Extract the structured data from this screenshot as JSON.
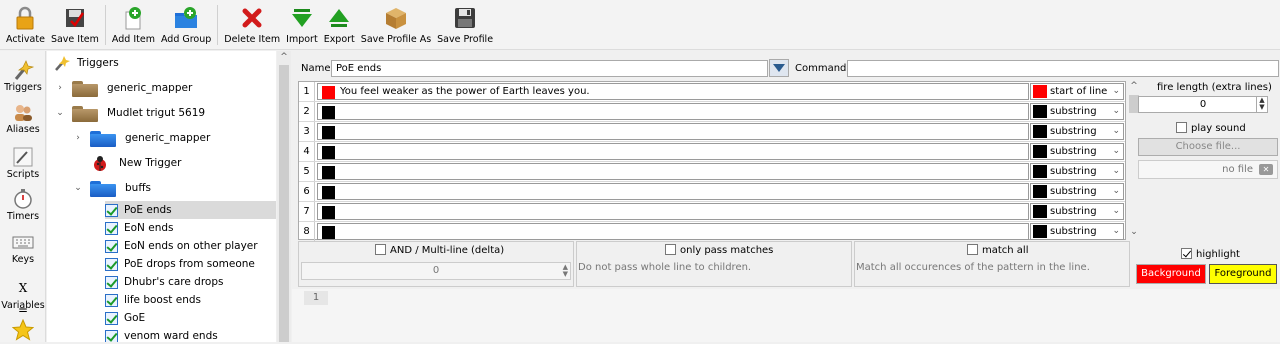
{
  "toolbar": {
    "buttons": [
      {
        "label": "Activate",
        "icon": "padlock-icon"
      },
      {
        "label": "Save Item",
        "icon": "save-item-icon"
      },
      {
        "label": "Add Item",
        "icon": "add-item-icon"
      },
      {
        "label": "Add Group",
        "icon": "add-group-icon"
      },
      {
        "label": "Delete Item",
        "icon": "delete-x-icon"
      },
      {
        "label": "Import",
        "icon": "import-arrow-icon"
      },
      {
        "label": "Export",
        "icon": "export-arrow-icon"
      },
      {
        "label": "Save Profile As",
        "icon": "package-box-icon"
      },
      {
        "label": "Save Profile",
        "icon": "floppy-disk-icon"
      }
    ]
  },
  "sidebar": {
    "items": [
      {
        "label": "Triggers",
        "icon": "triggers-wand-icon"
      },
      {
        "label": "Aliases",
        "icon": "aliases-people-icon"
      },
      {
        "label": "Scripts",
        "icon": "scripts-pen-icon"
      },
      {
        "label": "Timers",
        "icon": "stopwatch-icon"
      },
      {
        "label": "Keys",
        "icon": "keyboard-icon"
      },
      {
        "label": "Variables",
        "icon": "variables-x-icon",
        "glyph": "X ="
      },
      {
        "label": "",
        "icon": "star-icon"
      }
    ]
  },
  "tree": {
    "root": "Triggers",
    "nodes": [
      {
        "label": "generic_mapper",
        "type": "folder",
        "color": "brown",
        "arrow": "›"
      },
      {
        "label": "Mudlet trigut 5619",
        "type": "folder",
        "color": "brown",
        "arrow": "⌄"
      },
      {
        "label": "generic_mapper",
        "type": "folder",
        "color": "blue",
        "arrow": "›"
      },
      {
        "label": "New Trigger",
        "type": "trigger"
      },
      {
        "label": "buffs",
        "type": "folder",
        "color": "blue",
        "arrow": "⌄"
      },
      {
        "label": "PoE ends",
        "type": "item",
        "selected": true
      },
      {
        "label": "EoN ends",
        "type": "item"
      },
      {
        "label": "EoN ends on other player",
        "type": "item"
      },
      {
        "label": "PoE drops from someone",
        "type": "item"
      },
      {
        "label": "Dhubr's care drops",
        "type": "item"
      },
      {
        "label": "life boost ends",
        "type": "item"
      },
      {
        "label": "GoE",
        "type": "item"
      },
      {
        "label": "venom ward ends",
        "type": "item"
      }
    ]
  },
  "editor": {
    "name_label": "Name:",
    "name_value": "PoE ends",
    "command_label": "Command:",
    "command_value": "",
    "patterns": [
      {
        "num": "1",
        "text": "You feel weaker as the power of Earth leaves you.",
        "color": "#ff0000",
        "type": "start of line",
        "type_color": "#ff0000"
      },
      {
        "num": "2",
        "text": "",
        "color": "#000000",
        "type": "substring",
        "type_color": "#000000"
      },
      {
        "num": "3",
        "text": "",
        "color": "#000000",
        "type": "substring",
        "type_color": "#000000"
      },
      {
        "num": "4",
        "text": "",
        "color": "#000000",
        "type": "substring",
        "type_color": "#000000"
      },
      {
        "num": "5",
        "text": "",
        "color": "#000000",
        "type": "substring",
        "type_color": "#000000"
      },
      {
        "num": "6",
        "text": "",
        "color": "#000000",
        "type": "substring",
        "type_color": "#000000"
      },
      {
        "num": "7",
        "text": "",
        "color": "#000000",
        "type": "substring",
        "type_color": "#000000"
      },
      {
        "num": "8",
        "text": "",
        "color": "#000000",
        "type": "substring",
        "type_color": "#000000"
      }
    ],
    "and_multiline_label": "AND / Multi-line (delta)",
    "and_multiline_value": "0",
    "only_pass_label": "only pass matches",
    "only_pass_desc": "Do not pass whole line to children.",
    "match_all_label": "match all",
    "match_all_desc": "Match all occurences of the pattern in the line.",
    "fire_length_label": "fire length (extra lines)",
    "fire_length_value": "0",
    "play_sound_label": "play sound",
    "choose_file_label": "Choose file...",
    "no_file_label": "no file",
    "highlight_label": "highlight",
    "background_label": "Background",
    "foreground_label": "Foreground",
    "line_number": "1"
  },
  "colors": {
    "background_button": "#ff0000",
    "foreground_button": "#ffff00"
  }
}
